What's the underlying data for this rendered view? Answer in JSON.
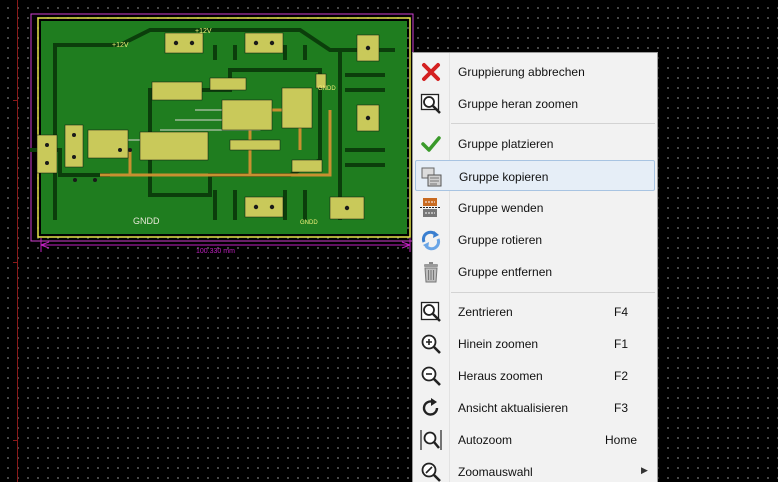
{
  "pcb": {
    "labels": {
      "plus12v_a": "+12V",
      "plus12v_b": "+12V",
      "gndd_bottom": "GNDD",
      "gndd_top": "GNDD",
      "gndd_bottom_right": "GNDD",
      "dimension": "100.330 mm"
    }
  },
  "context_menu": {
    "items": [
      {
        "label": "Gruppierung abbrechen",
        "icon": "cancel-x-icon",
        "shortcut": ""
      },
      {
        "label": "Gruppe heran zoomen",
        "icon": "zoom-block-icon",
        "shortcut": ""
      },
      {
        "label": "Gruppe platzieren",
        "icon": "checkmark-icon",
        "shortcut": ""
      },
      {
        "label": "Gruppe kopieren",
        "icon": "copy-block-icon",
        "shortcut": ""
      },
      {
        "label": "Gruppe wenden",
        "icon": "flip-block-icon",
        "shortcut": ""
      },
      {
        "label": "Gruppe rotieren",
        "icon": "rotate-block-icon",
        "shortcut": ""
      },
      {
        "label": "Gruppe entfernen",
        "icon": "trash-icon",
        "shortcut": ""
      },
      {
        "label": "Zentrieren",
        "icon": "zoom-center-icon",
        "shortcut": "F4"
      },
      {
        "label": "Hinein zoomen",
        "icon": "zoom-in-icon",
        "shortcut": "F1"
      },
      {
        "label": "Heraus zoomen",
        "icon": "zoom-out-icon",
        "shortcut": "F2"
      },
      {
        "label": "Ansicht aktualisieren",
        "icon": "refresh-icon",
        "shortcut": "F3"
      },
      {
        "label": "Autozoom",
        "icon": "zoom-auto-icon",
        "shortcut": "Home"
      },
      {
        "label": "Zoomauswahl",
        "icon": "zoom-select-icon",
        "shortcut": "",
        "submenu": true
      }
    ],
    "highlighted_index": 3
  },
  "colors": {
    "board": "#1f7d1f",
    "board_dark": "#0f5a0f",
    "copper_pad": "#c9c95a",
    "trace_orange": "#c89030",
    "outline_yellow": "#e6e64a",
    "dimension": "#c020c0",
    "menu_bg": "#f2f2f2",
    "menu_highlight": "#e6eef7"
  }
}
